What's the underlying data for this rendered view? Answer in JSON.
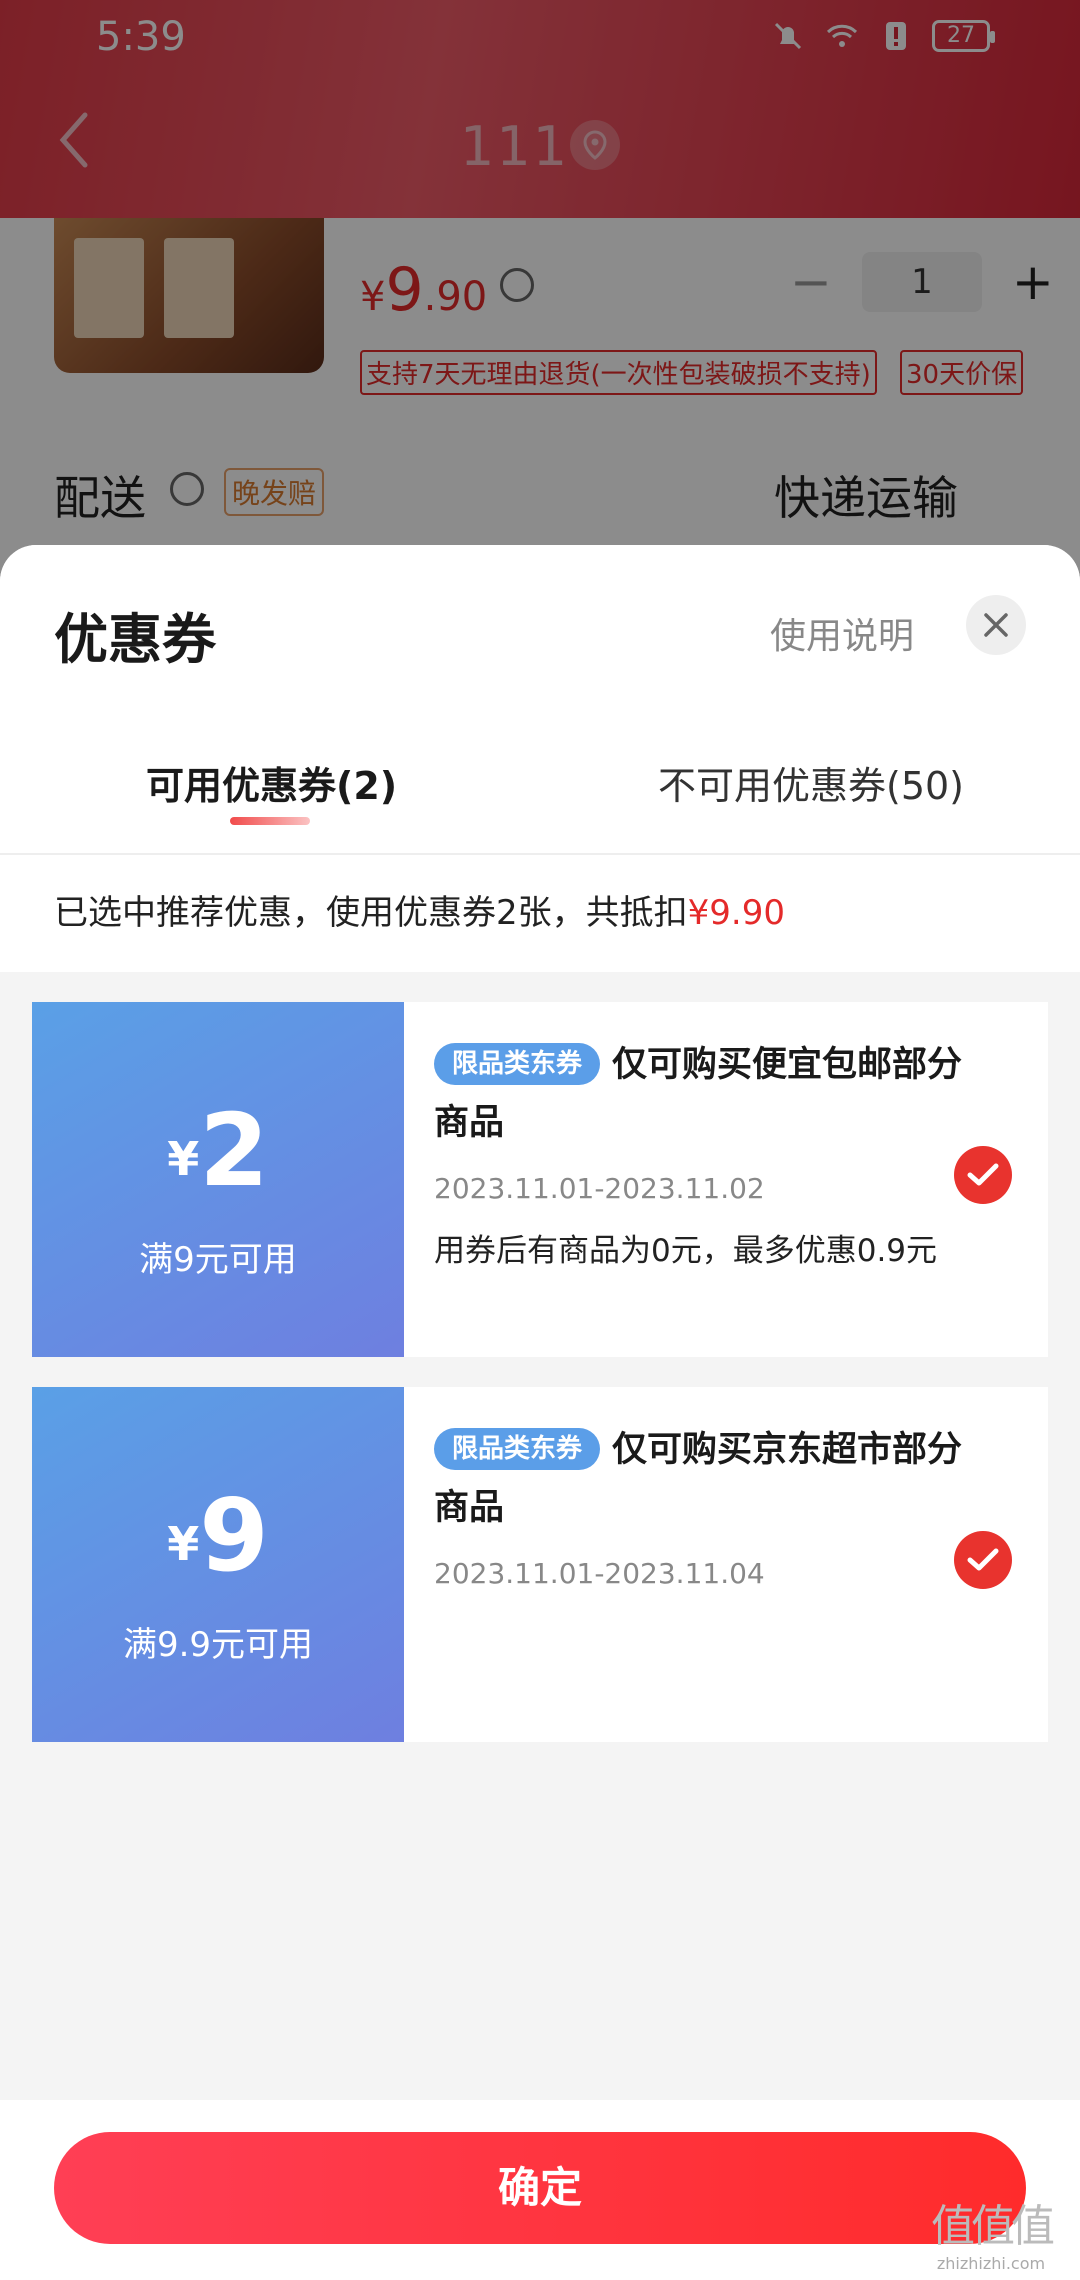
{
  "status_bar": {
    "time": "5:39",
    "battery": "27"
  },
  "header": {
    "title": "111"
  },
  "product": {
    "price_yen": "¥",
    "price_int": "9",
    "price_dec": ".90",
    "quantity": "1",
    "qty_minus": "−",
    "qty_plus": "+",
    "tag_return": "支持7天无理由退货(一次性包装破损不支持)",
    "tag_price_protect": "30天价保"
  },
  "delivery": {
    "label": "配送",
    "late_tag": "晚发赔",
    "method": "快递运输"
  },
  "sheet": {
    "title": "优惠券",
    "usage_link": "使用说明",
    "tabs": [
      {
        "label": "可用优惠券(2)",
        "active": true
      },
      {
        "label": "不可用优惠券(50)",
        "active": false
      }
    ],
    "summary_text": "已选中推荐优惠，使用优惠券2张，共抵扣",
    "summary_amount": "¥9.90"
  },
  "coupons": [
    {
      "currency": "¥",
      "amount": "2",
      "condition": "满9元可用",
      "tag": "限品类东券",
      "title": "仅可购买便宜包邮部分商品",
      "date_range": "2023.11.01-2023.11.02",
      "note": "用券后有商品为0元，最多优惠0.9元",
      "selected": true
    },
    {
      "currency": "¥",
      "amount": "9",
      "condition": "满9.9元可用",
      "tag": "限品类东券",
      "title": "仅可购买京东超市部分商品",
      "date_range": "2023.11.01-2023.11.04",
      "note": "",
      "selected": true
    }
  ],
  "footer": {
    "confirm_label": "确定"
  },
  "watermark": {
    "mark": "值值值",
    "url": "zhizhizhi.com"
  },
  "colors": {
    "accent_red": "#e42a2a",
    "coupon_blue": "#5b9ee8",
    "header_red": "#e23b48"
  }
}
